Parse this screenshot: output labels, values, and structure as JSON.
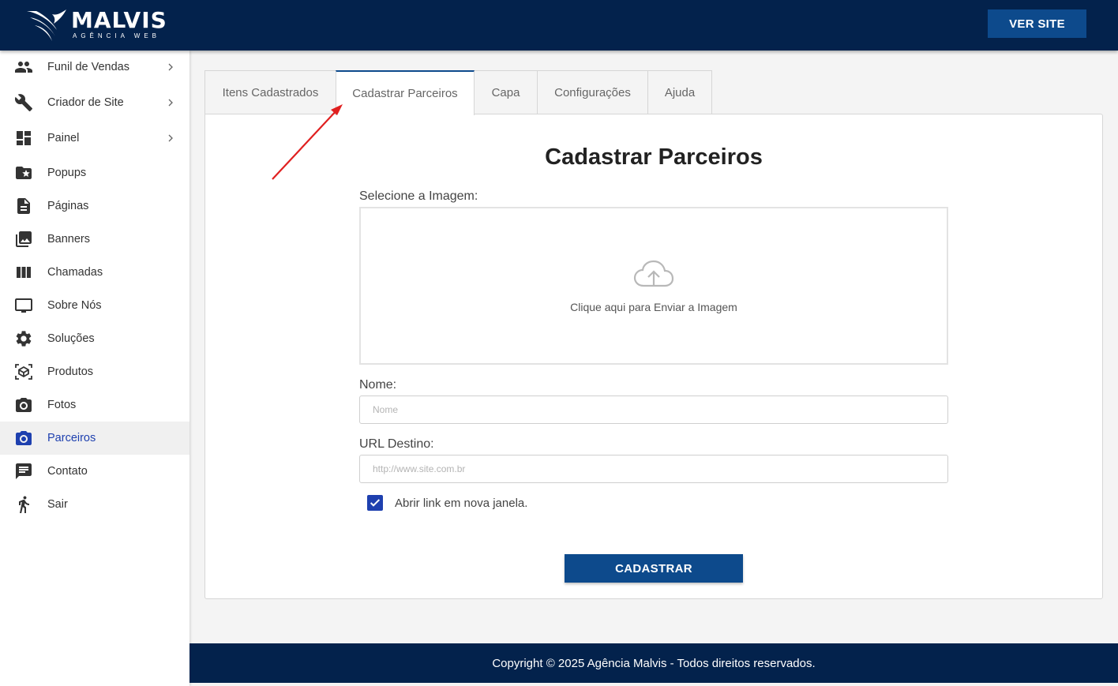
{
  "header": {
    "logo_name": "MALVIS",
    "logo_sub": "AGÊNCIA WEB",
    "ver_site_label": "VER SITE",
    "bg_color": "#03224c",
    "button_color": "#0d4a8c"
  },
  "sidebar": {
    "items": [
      {
        "label": "Funil de Vendas",
        "icon": "people-icon",
        "has_submenu": true
      },
      {
        "label": "Criador de Site",
        "icon": "wrench-icon",
        "has_submenu": true
      },
      {
        "label": "Painel",
        "icon": "dashboard-icon",
        "has_submenu": true
      },
      {
        "label": "Popups",
        "icon": "folder-star-icon"
      },
      {
        "label": "Páginas",
        "icon": "document-icon"
      },
      {
        "label": "Banners",
        "icon": "photo-library-icon"
      },
      {
        "label": "Chamadas",
        "icon": "columns-icon"
      },
      {
        "label": "Sobre Nós",
        "icon": "monitor-icon"
      },
      {
        "label": "Soluções",
        "icon": "gear-icon"
      },
      {
        "label": "Produtos",
        "icon": "box-icon"
      },
      {
        "label": "Fotos",
        "icon": "camera-icon"
      },
      {
        "label": "Parceiros",
        "icon": "camera-icon",
        "active": true
      },
      {
        "label": "Contato",
        "icon": "chat-icon"
      },
      {
        "label": "Sair",
        "icon": "exit-person-icon"
      }
    ],
    "active_color": "#1e40af"
  },
  "tabs": [
    {
      "label": "Itens Cadastrados"
    },
    {
      "label": "Cadastrar Parceiros",
      "active": true
    },
    {
      "label": "Capa"
    },
    {
      "label": "Configurações"
    },
    {
      "label": "Ajuda"
    }
  ],
  "form": {
    "title": "Cadastrar Parceiros",
    "image_label": "Selecione a Imagem:",
    "upload_text": "Clique aqui para Enviar a Imagem",
    "name_label": "Nome:",
    "name_placeholder": "Nome",
    "url_label": "URL Destino:",
    "url_placeholder": "http://www.site.com.br",
    "new_window_label": "Abrir link em nova janela.",
    "new_window_checked": true,
    "submit_label": "CADASTRAR"
  },
  "footer": {
    "text": "Copyright © 2025 Agência Malvis - Todos direitos reservados."
  },
  "annotation": {
    "arrow_color": "#e02020"
  }
}
